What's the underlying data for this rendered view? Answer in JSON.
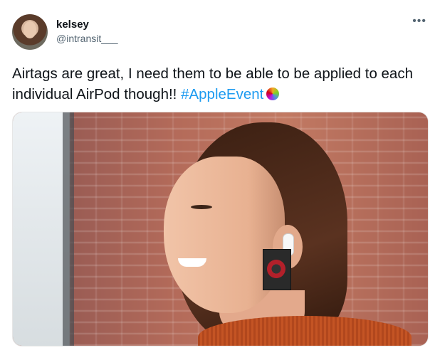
{
  "tweet": {
    "author": {
      "display_name": "kelsey",
      "handle": "@intransit___"
    },
    "more_icon": "more-horizontal-icon",
    "text_before_hashtag": "Airtags are great, I need them to be able to be applied to each individual AirPod though!! ",
    "hashtag": "#AppleEvent",
    "hashtag_emoji_icon": "apple-event-logo-icon",
    "colors": {
      "hashtag": "#1d9bf0",
      "handle": "#536471",
      "text": "#0f1419"
    },
    "media": {
      "type": "photo"
    }
  }
}
